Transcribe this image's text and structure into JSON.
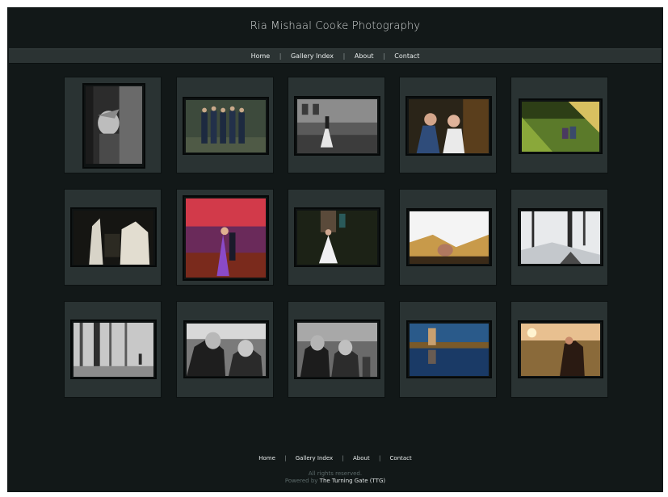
{
  "header": {
    "site_title": "Ria Mishaal Cooke Photography"
  },
  "nav": {
    "home": "Home",
    "gallery_index": "Gallery Index",
    "about": "About",
    "contact": "Contact",
    "separator": "|"
  },
  "gallery": {
    "thumbnails": [
      {
        "subject": "woman laughing in doorway, black and white"
      },
      {
        "subject": "groomsmen group in suits"
      },
      {
        "subject": "bride and groom by building, black and white"
      },
      {
        "subject": "couple kissing portrait"
      },
      {
        "subject": "couple sitting in sunlit park"
      },
      {
        "subject": "white horses with carriage"
      },
      {
        "subject": "first dance under purple lights"
      },
      {
        "subject": "bride on stairs at night"
      },
      {
        "subject": "woman under white sheet"
      },
      {
        "subject": "winter trees in snow"
      },
      {
        "subject": "figure among trees, black and white"
      },
      {
        "subject": "couple laughing, black and white"
      },
      {
        "subject": "couple sitting close, black and white"
      },
      {
        "subject": "couple reflected in lake at dusk"
      },
      {
        "subject": "couple embracing at sunset"
      }
    ]
  },
  "footer": {
    "home": "Home",
    "gallery_index": "Gallery Index",
    "about": "About",
    "contact": "Contact",
    "separator": "|",
    "rights": "All rights reserved.",
    "powered_prefix": "Powered by",
    "powered_link": "The Turning Gate (TTG)"
  }
}
